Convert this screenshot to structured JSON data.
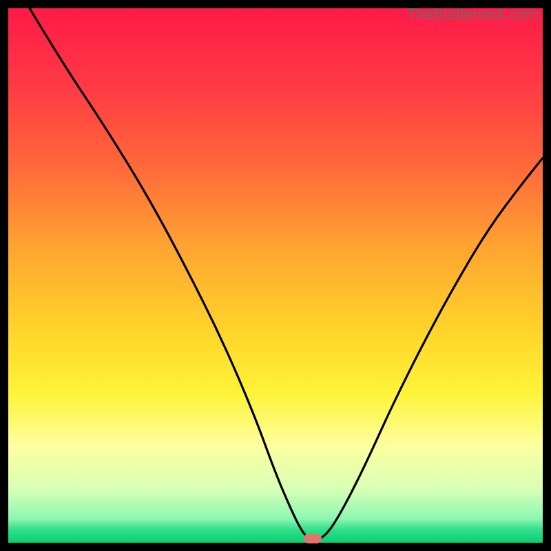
{
  "watermark": "TheBottleneck.com",
  "chart_data": {
    "type": "line",
    "title": "",
    "xlabel": "",
    "ylabel": "",
    "xlim": [
      0,
      100
    ],
    "ylim": [
      0,
      100
    ],
    "grid": false,
    "legend": false,
    "gradient_stops": [
      {
        "offset": 0.0,
        "color": "#ff1a48"
      },
      {
        "offset": 0.15,
        "color": "#ff3b44"
      },
      {
        "offset": 0.3,
        "color": "#ff6a3a"
      },
      {
        "offset": 0.45,
        "color": "#ffa531"
      },
      {
        "offset": 0.6,
        "color": "#ffd32a"
      },
      {
        "offset": 0.72,
        "color": "#fff338"
      },
      {
        "offset": 0.82,
        "color": "#fdffa0"
      },
      {
        "offset": 0.9,
        "color": "#d7ffb5"
      },
      {
        "offset": 0.955,
        "color": "#8cf7b2"
      },
      {
        "offset": 0.975,
        "color": "#32e08a"
      },
      {
        "offset": 1.0,
        "color": "#08cf6f"
      }
    ],
    "series": [
      {
        "name": "bottleneck-curve",
        "color": "#000000",
        "x": [
          4,
          10,
          18,
          26,
          33,
          40,
          46,
          50,
          53,
          55,
          56.5,
          58,
          60,
          63,
          67,
          72,
          78,
          84,
          90,
          96,
          100
        ],
        "y": [
          100,
          90,
          78,
          65,
          52,
          38,
          24,
          13,
          6,
          2,
          0.5,
          0.5,
          2,
          7,
          15,
          26,
          38,
          49,
          59,
          67,
          72
        ]
      }
    ],
    "marker": {
      "x": 57,
      "y": 0.8,
      "color": "#e2766e"
    }
  }
}
